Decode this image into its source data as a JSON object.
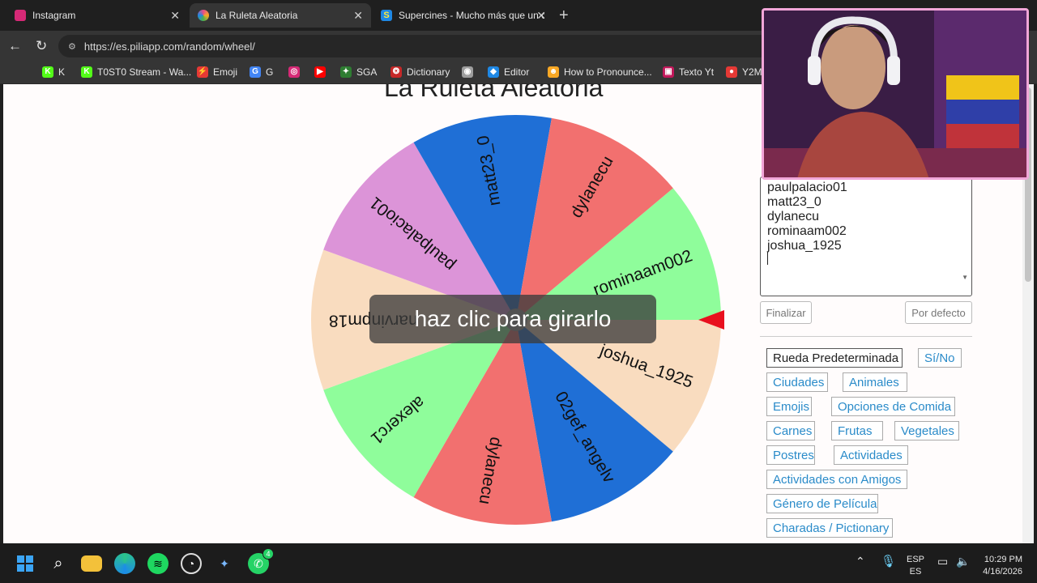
{
  "tabs": [
    {
      "title": "Instagram",
      "color": "#d62976"
    },
    {
      "title": "La Ruleta Aleatoria",
      "color": "#e84c88"
    },
    {
      "title": "Supercines - Mucho más que un c",
      "color": "#1e88e5"
    }
  ],
  "address": {
    "url": "https://es.piliapp.com/random/wheel/"
  },
  "bookmarks": [
    {
      "label": "K",
      "icon": "K",
      "color": "#53fc18"
    },
    {
      "label": "T0ST0 Stream - Wa...",
      "icon": "K",
      "color": "#53fc18"
    },
    {
      "label": "Emoji",
      "icon": "⚡",
      "color": "#e53935"
    },
    {
      "label": "G",
      "icon": "G",
      "color": "#4285f4"
    },
    {
      "label": "",
      "icon": "◎",
      "color": "#d62976"
    },
    {
      "label": "",
      "icon": "▶",
      "color": "#ff0000"
    },
    {
      "label": "SGA",
      "icon": "✦",
      "color": "#2e7d32"
    },
    {
      "label": "Dictionary",
      "icon": "❂",
      "color": "#c62828"
    },
    {
      "label": "",
      "icon": "◉",
      "color": "#9e9e9e"
    },
    {
      "label": "Editor",
      "icon": "◆",
      "color": "#1e88e5"
    },
    {
      "label": "How to Pronounce...",
      "icon": "☻",
      "color": "#f9a825"
    },
    {
      "label": "Texto Yt",
      "icon": "▣",
      "color": "#c2185b"
    },
    {
      "label": "Y2M",
      "icon": "●",
      "color": "#e53935"
    }
  ],
  "page": {
    "title": "La Ruleta Aleatoria",
    "spin_hint": "haz clic para girarlo",
    "names": [
      "paulpalacio01",
      "matt23_0",
      "dylanecu",
      "rominaam002",
      "joshua_1925"
    ],
    "finish_button": "Finalizar",
    "default_button": "Por defecto"
  },
  "wheel_segments": [
    {
      "label": "rominaam002",
      "color": "#8ffd9b"
    },
    {
      "label": "joshua_1925",
      "color": "#f9dcbf"
    },
    {
      "label": "02gef_angelv",
      "color": "#1f6fd6"
    },
    {
      "label": "dylanecu",
      "color": "#f2706f"
    },
    {
      "label": "alexerc1",
      "color": "#8ffd9b"
    },
    {
      "label": "narvinpm18",
      "color": "#f9dcbf"
    },
    {
      "label": "paulpalacio01",
      "color": "#dc94d8"
    },
    {
      "label": "matt23_0",
      "color": "#1f6fd6"
    },
    {
      "label": "dylanecu",
      "color": "#f2706f"
    }
  ],
  "presets": [
    {
      "label": "Rueda Predeterminada",
      "selected": true
    },
    {
      "label": "Sí/No",
      "selected": false
    },
    {
      "label": "Ciudades",
      "selected": false
    },
    {
      "label": "Animales",
      "selected": false
    },
    {
      "label": "Emojis",
      "selected": false
    },
    {
      "label": "Opciones de Comida",
      "selected": false
    },
    {
      "label": "Carnes",
      "selected": false
    },
    {
      "label": "Frutas",
      "selected": false
    },
    {
      "label": "Vegetales",
      "selected": false
    },
    {
      "label": "Postres",
      "selected": false
    },
    {
      "label": "Actividades",
      "selected": false
    },
    {
      "label": "Actividades con Amigos",
      "selected": false
    },
    {
      "label": "Género de Película",
      "selected": false
    },
    {
      "label": "Charadas / Pictionary",
      "selected": false
    }
  ],
  "taskbar": {
    "lang_top": "ESP",
    "lang_bottom": "ES",
    "time": "10:29 PM",
    "date": "4/16/2026",
    "whatsapp_badge": "4"
  }
}
